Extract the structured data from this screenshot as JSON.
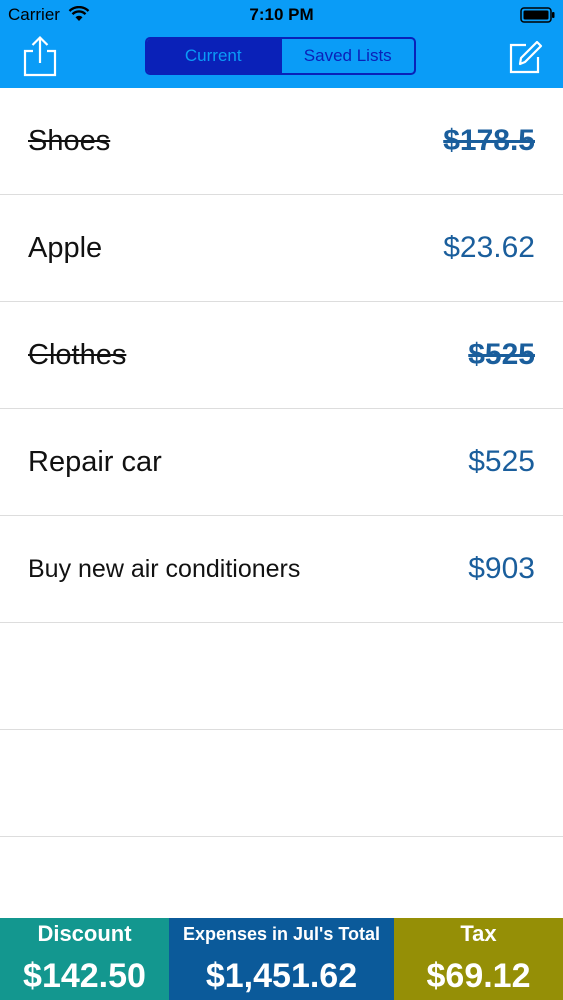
{
  "status_bar": {
    "carrier": "Carrier",
    "time": "7:10 PM"
  },
  "nav": {
    "tabs": [
      {
        "label": "Current",
        "active": true
      },
      {
        "label": "Saved Lists",
        "active": false
      }
    ]
  },
  "items": [
    {
      "name": "Shoes",
      "price": "$178.5",
      "struck": true
    },
    {
      "name": "Apple",
      "price": "$23.62",
      "struck": false
    },
    {
      "name": "Clothes",
      "price": "$525",
      "struck": true
    },
    {
      "name": "Repair car",
      "price": "$525",
      "struck": false
    },
    {
      "name": "Buy new air conditioners",
      "price": "$903",
      "struck": false
    }
  ],
  "summary": {
    "discount": {
      "label": "Discount",
      "value": "$142.50",
      "color": "#13978f"
    },
    "total": {
      "label": "Expenses in Jul's Total",
      "value": "$1,451.62",
      "color": "#0b5a9a"
    },
    "tax": {
      "label": "Tax",
      "value": "$69.12",
      "color": "#958f06"
    }
  },
  "colors": {
    "nav_background": "#0a9cf7",
    "segment_tint": "#0a21b8",
    "price_text": "#1a5e9c"
  }
}
